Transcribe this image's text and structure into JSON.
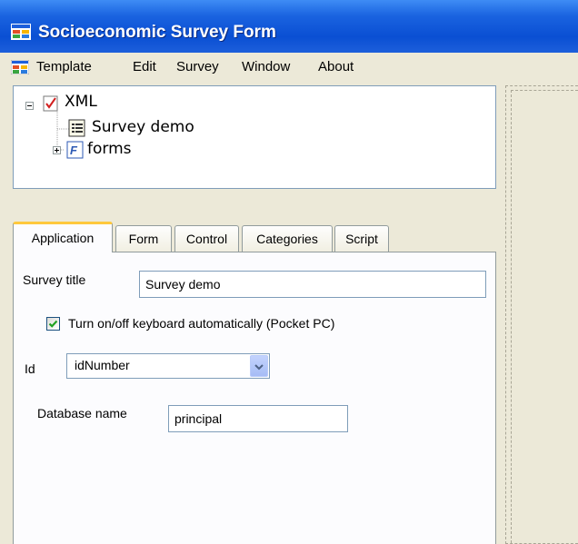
{
  "window": {
    "title": "Socioeconomic Survey Form"
  },
  "menu": {
    "items": [
      "Template",
      "Edit",
      "Survey",
      "Window",
      "About"
    ]
  },
  "tree": {
    "root": "XML",
    "children": [
      "Survey demo",
      "forms"
    ]
  },
  "tabs": [
    "Application",
    "Form",
    "Control",
    "Categories",
    "Script"
  ],
  "application": {
    "survey_title_label": "Survey title",
    "survey_title_value": "Survey demo",
    "keyboard_checkbox_label": "Turn on/off keyboard automatically (Pocket PC)",
    "keyboard_checked": true,
    "id_label": "Id",
    "id_value": "idNumber",
    "database_label": "Database name",
    "database_value": "principal"
  },
  "colors": {
    "titlebar": "#0A4FD3",
    "active_tab_accent": "#FFC83C",
    "background": "#ECE9D8"
  }
}
